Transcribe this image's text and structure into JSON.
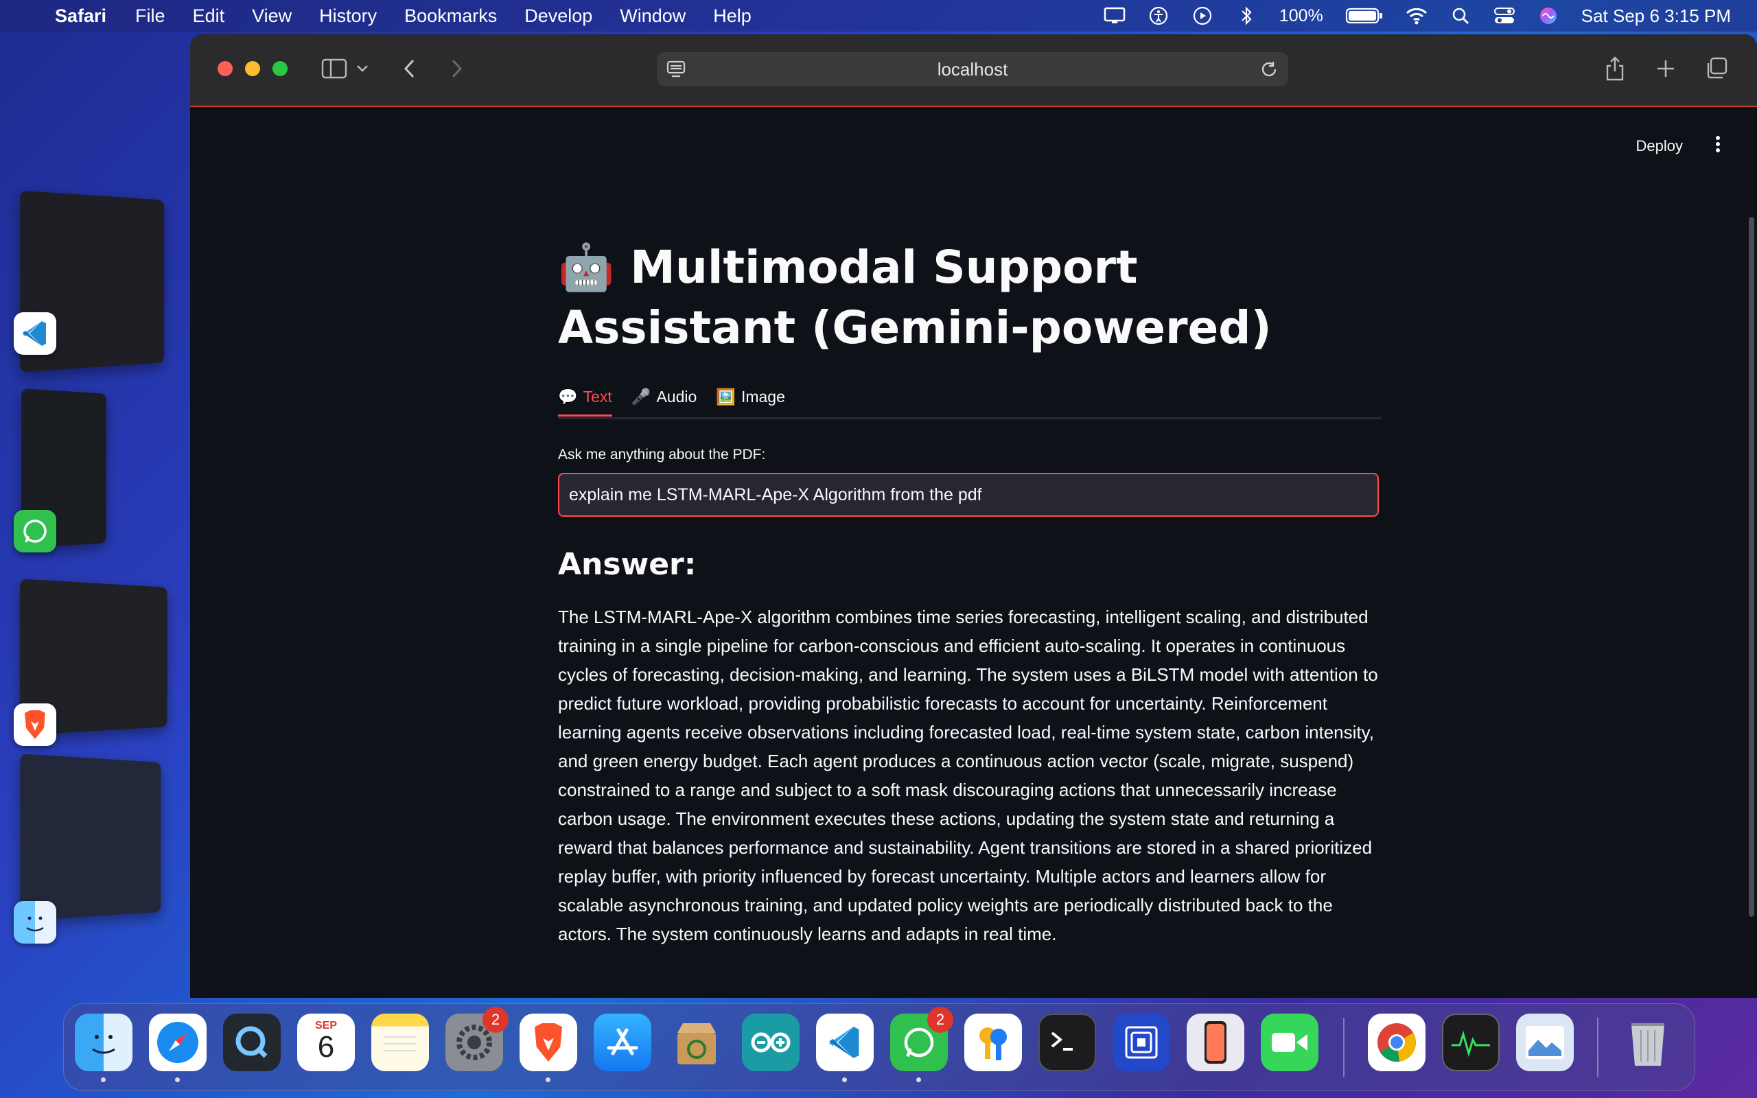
{
  "menubar": {
    "app_name": "Safari",
    "items": [
      "File",
      "Edit",
      "View",
      "History",
      "Bookmarks",
      "Develop",
      "Window",
      "Help"
    ],
    "battery": "100%",
    "datetime": "Sat Sep 6  3:15 PM"
  },
  "browser": {
    "url": "localhost"
  },
  "streamlit": {
    "deploy_label": "Deploy",
    "title_icon": "🤖",
    "title": "Multimodal Support Assistant (Gemini-powered)",
    "tabs": [
      {
        "icon": "💬",
        "label": "Text",
        "active": true
      },
      {
        "icon": "🎤",
        "label": "Audio",
        "active": false
      },
      {
        "icon": "🖼️",
        "label": "Image",
        "active": false
      }
    ],
    "input_label": "Ask me anything about the PDF:",
    "input_value": "explain me LSTM-MARL-Ape-X Algorithm from the pdf",
    "answer_heading": "Answer:",
    "answer_text": "The LSTM-MARL-Ape-X algorithm combines time series forecasting, intelligent scaling, and distributed training in a single pipeline for carbon-conscious and efficient auto-scaling. It operates in continuous cycles of forecasting, decision-making, and learning. The system uses a BiLSTM model with attention to predict future workload, providing probabilistic forecasts to account for uncertainty. Reinforcement learning agents receive observations including forecasted load, real-time system state, carbon intensity, and green energy budget. Each agent produces a continuous action vector (scale, migrate, suspend) constrained to a range and subject to a soft mask discouraging actions that unnecessarily increase carbon usage. The environment executes these actions, updating the system state and returning a reward that balances performance and sustainability. Agent transitions are stored in a shared prioritized replay buffer, with priority influenced by forecast uncertainty. Multiple actors and learners allow for scalable asynchronous training, and updated policy weights are periodically distributed back to the actors. The system continuously learns and adapts in real time."
  },
  "dock": {
    "calendar_month": "SEP",
    "calendar_day": "6",
    "settings_badge": "2",
    "whatsapp_badge": "2"
  },
  "colors": {
    "accent": "#ff4b4b",
    "app_bg": "#0e1117",
    "input_bg": "#262730"
  }
}
